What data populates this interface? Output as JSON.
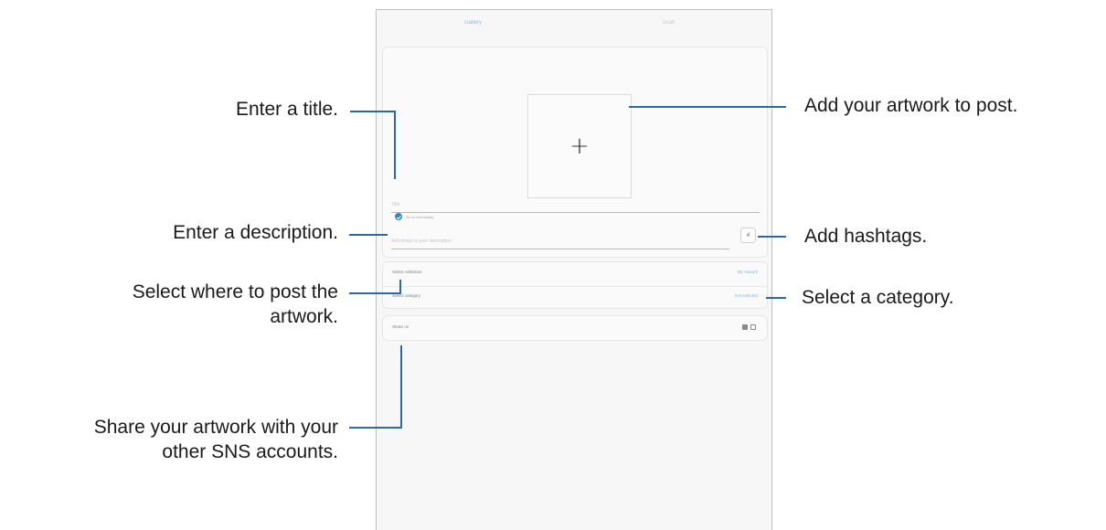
{
  "tabs": [
    "Gallery",
    "Draft"
  ],
  "artwork": {
    "add_icon": "plus-icon"
  },
  "checkbox_label": "Go to community",
  "title_placeholder": "Title",
  "description_placeholder": "Add things to your description",
  "hashtag_icon": "#",
  "settings": [
    {
      "label": "Select collection",
      "value": "My Artwork"
    },
    {
      "label": "Select category",
      "value": "Not selected"
    }
  ],
  "share": {
    "label": "Share on",
    "icons": [
      "facebook-icon",
      "twitter-icon"
    ]
  },
  "callouts": {
    "title": "Enter a title.",
    "description": "Enter a description.",
    "where_line1": "Select where to post the",
    "where_line2": "artwork.",
    "share_line1": "Share your artwork with your",
    "share_line2": "other SNS accounts.",
    "add_artwork": "Add your artwork to post.",
    "hashtags": "Add hashtags.",
    "category": "Select a category."
  },
  "colors": {
    "accent": "#2a6aa6",
    "link": "#7eb6de"
  }
}
